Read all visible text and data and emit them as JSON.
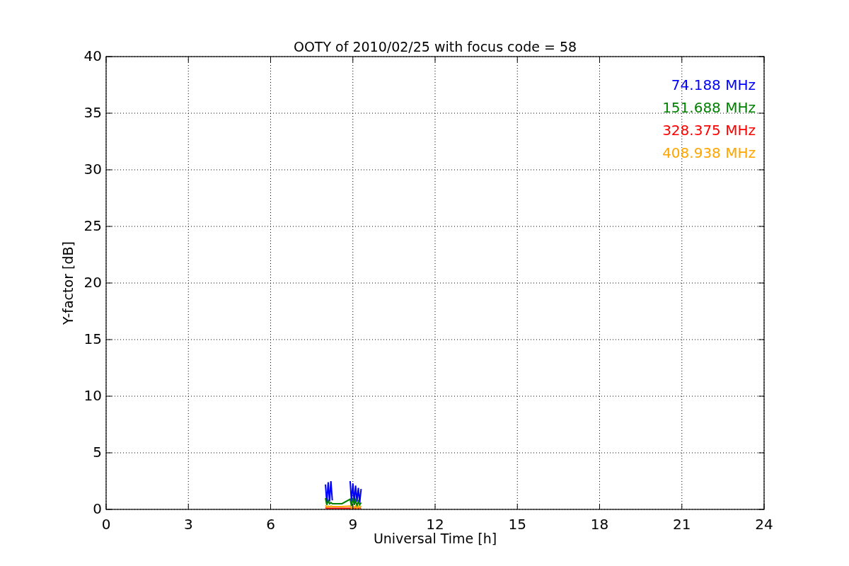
{
  "chart_data": {
    "type": "line",
    "title": "OOTY of 2010/02/25 with focus code = 58",
    "xlabel": "Universal Time [h]",
    "ylabel": "Y-factor [dB]",
    "x": [
      8.0,
      8.05,
      8.1,
      8.15,
      8.2,
      8.25,
      8.6,
      8.9,
      8.95,
      9.0,
      9.05,
      9.1,
      9.15,
      9.2,
      9.25,
      9.3
    ],
    "series": [
      {
        "name": "74.188 MHz",
        "color": "#0000ff",
        "values": [
          2.2,
          0.6,
          2.4,
          0.7,
          2.5,
          0.8,
          null,
          2.5,
          0.7,
          2.3,
          0.6,
          2.1,
          0.7,
          1.9,
          0.6,
          1.8
        ]
      },
      {
        "name": "151.688 MHz",
        "color": "#008000",
        "values": [
          1.0,
          0.4,
          0.8,
          0.5,
          0.6,
          0.5,
          0.5,
          0.9,
          0.3,
          1.0,
          0.4,
          0.8,
          0.3,
          0.7,
          0.4,
          0.6
        ]
      },
      {
        "name": "328.375 MHz",
        "color": "#ff0000",
        "values": [
          0.15,
          0.1,
          0.1,
          0.1,
          0.1,
          0.1,
          0.1,
          0.1,
          0.1,
          0.1,
          0.1,
          0.1,
          0.1,
          0.1,
          0.1,
          0.1
        ]
      },
      {
        "name": "408.938 MHz",
        "color": "#ffa500",
        "values": [
          0.35,
          0.2,
          0.3,
          0.2,
          0.3,
          0.25,
          0.25,
          0.3,
          0.1,
          0.3,
          0.15,
          0.3,
          0.1,
          0.3,
          0.15,
          0.3
        ]
      }
    ],
    "grid": true,
    "xlim": [
      0,
      24
    ],
    "ylim": [
      0,
      40
    ],
    "xticks": [
      0,
      3,
      6,
      9,
      12,
      15,
      18,
      21,
      24
    ],
    "yticks": [
      0,
      5,
      10,
      15,
      20,
      25,
      30,
      35,
      40
    ]
  }
}
